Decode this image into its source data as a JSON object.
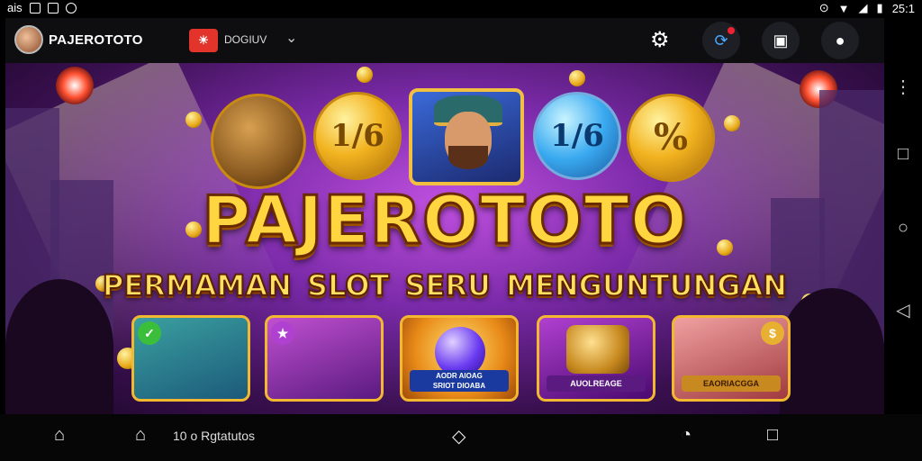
{
  "status_bar": {
    "carrier": "ais",
    "time": "25:1"
  },
  "app_bar": {
    "title": "PAJEROTOTO",
    "domain_badge": "☀",
    "domain_text": "DOGIUV",
    "settings_icon": "gear-icon",
    "sync_icon": "refresh-icon",
    "calendar_icon": "calendar-icon",
    "profile_icon": "user-icon"
  },
  "banner": {
    "headline": "PAJEROTOTO",
    "subheadline": "PERMAMAN SLOT SERU  MENGUNTUNGAN",
    "coins": [
      {
        "label": "1/6",
        "variant": "gold"
      },
      {
        "label": "1/6",
        "variant": "blue"
      },
      {
        "label": "%",
        "variant": "gold"
      }
    ],
    "cards": [
      {
        "caption": "",
        "badge": "✓",
        "badge_color": "#3bbf3b",
        "theme": "#3a8a6a"
      },
      {
        "caption": "",
        "badge": "★",
        "badge_color": "#b040d0",
        "theme": "#7a2a90"
      },
      {
        "caption": "AODR AIOAG\nSRIOT DIOABA",
        "badge": "",
        "badge_color": "",
        "theme": "#e89020"
      },
      {
        "caption": "AUOLREAGE",
        "badge": "",
        "badge_color": "",
        "theme": "#8a2aa0"
      },
      {
        "caption": "EAORIACGGA",
        "badge": "$",
        "badge_color": "#e8b030",
        "theme": "#a03a20"
      }
    ]
  },
  "bottom_nav": {
    "label": "10 o Rgtatutos"
  }
}
